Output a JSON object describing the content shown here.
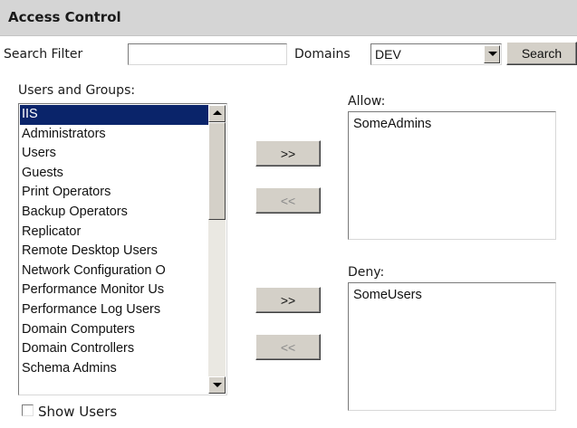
{
  "header": {
    "title": "Access Control"
  },
  "search": {
    "filter_label": "Search Filter",
    "filter_value": "",
    "domains_label": "Domains",
    "domain_selected": "DEV",
    "search_button": "Search"
  },
  "users_groups": {
    "label": "Users and Groups:",
    "items": [
      "IIS",
      "Administrators",
      "Users",
      "Guests",
      "Print Operators",
      "Backup Operators",
      "Replicator",
      "Remote Desktop Users",
      "Network Configuration O",
      "Performance Monitor Us",
      "Performance Log Users",
      "Domain Computers",
      "Domain Controllers",
      "Schema Admins"
    ],
    "selected_item": "IIS",
    "show_users_label": "Show Users",
    "show_users_checked": false
  },
  "allow": {
    "label": "Allow:",
    "entries": [
      "SomeAdmins"
    ],
    "add_button": ">>",
    "remove_button": "<<"
  },
  "deny": {
    "label": "Deny:",
    "entries": [
      "SomeUsers"
    ],
    "add_button": ">>",
    "remove_button": "<<"
  },
  "colors": {
    "header_bg": "#d5d5d5",
    "selection_bg": "#0a246a",
    "button_face": "#d4d0c8"
  }
}
